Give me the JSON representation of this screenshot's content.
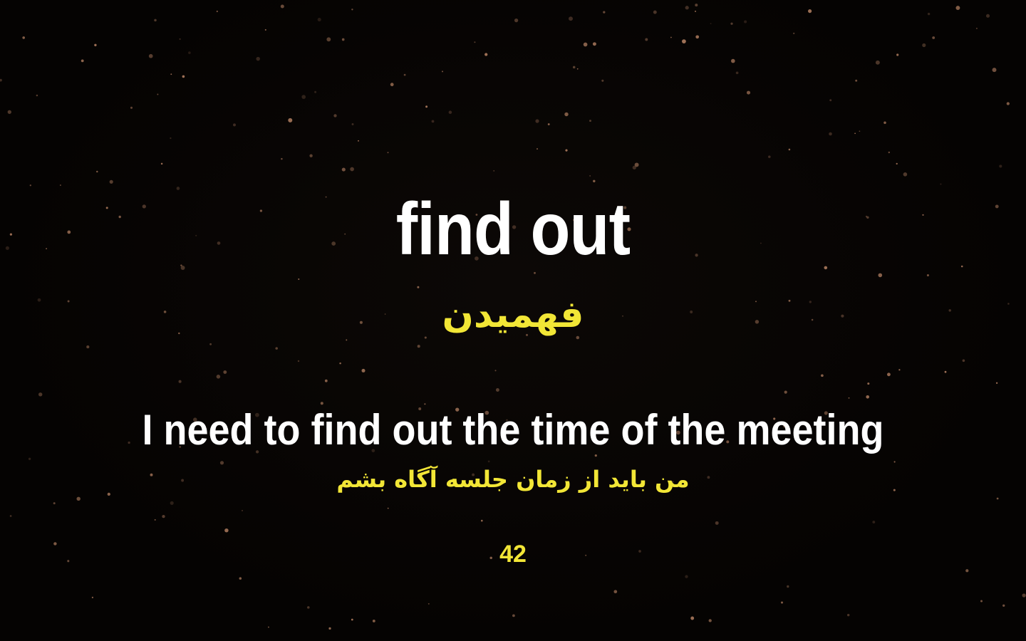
{
  "slide": {
    "phrase": "find out",
    "phrase_translation": "فهمیدن",
    "example_sentence": "I need to find out the time of the meeting",
    "example_translation": "من باید از زمان جلسه آگاه بشم",
    "number": "42"
  },
  "colors": {
    "background": "#050302",
    "phrase": "#ffffff",
    "translation": "#f2e636",
    "particle": "#e0a07a"
  }
}
